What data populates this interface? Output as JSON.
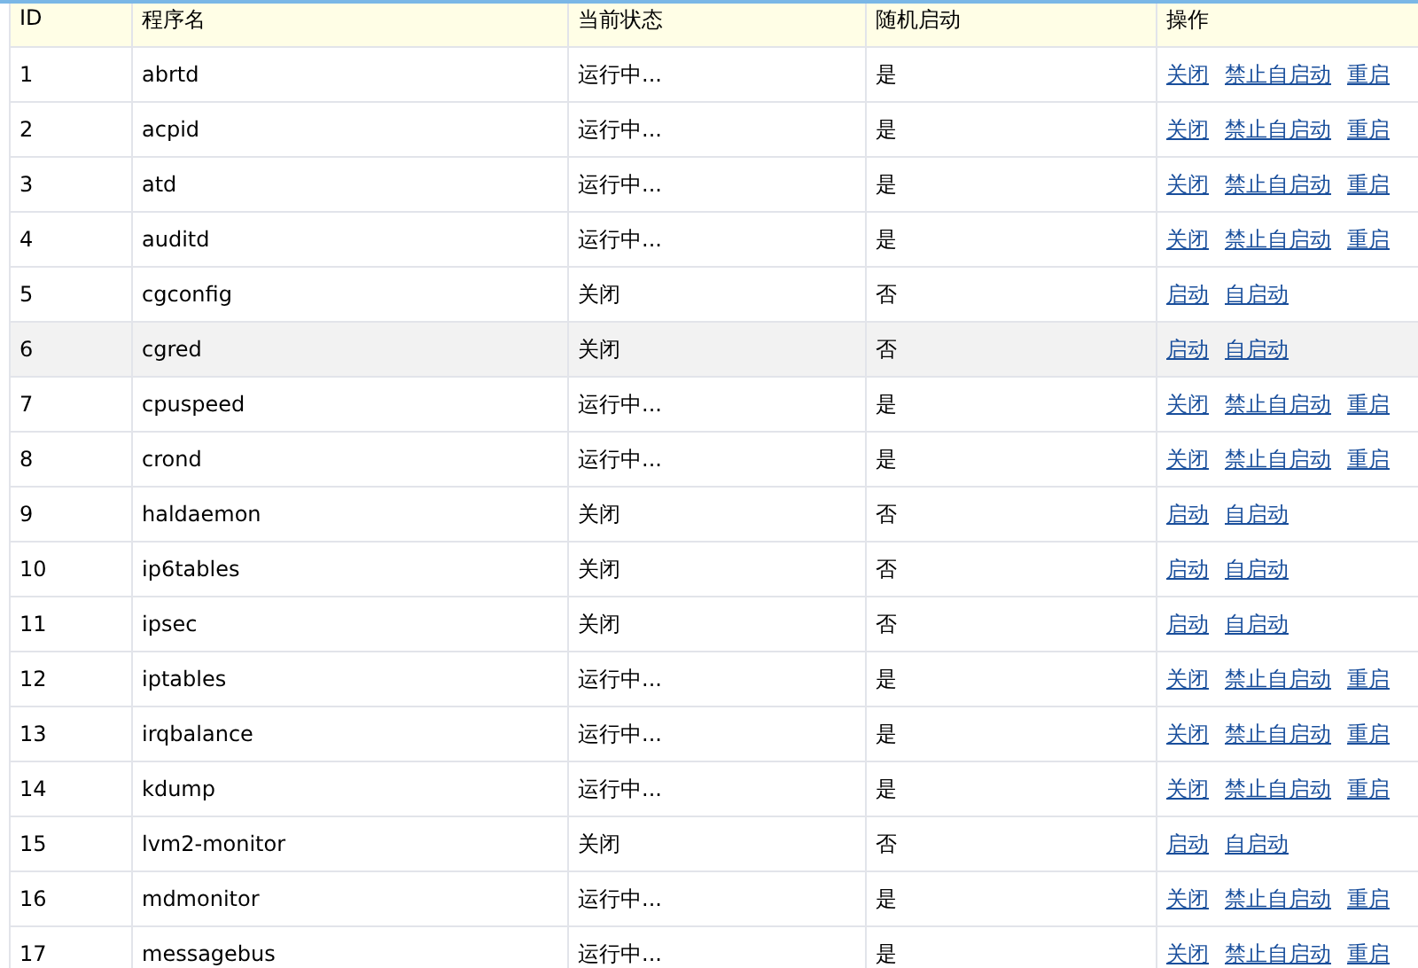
{
  "table": {
    "columns": [
      "ID",
      "程序名",
      "当前状态",
      "随机启动",
      "操作"
    ],
    "rows": [
      {
        "id": "1",
        "name": "abrtd",
        "status": "运行中...",
        "autostart": "是",
        "selected": false,
        "actions": [
          "关闭",
          "禁止自启动",
          "重启"
        ]
      },
      {
        "id": "2",
        "name": "acpid",
        "status": "运行中...",
        "autostart": "是",
        "selected": false,
        "actions": [
          "关闭",
          "禁止自启动",
          "重启"
        ]
      },
      {
        "id": "3",
        "name": "atd",
        "status": "运行中...",
        "autostart": "是",
        "selected": false,
        "actions": [
          "关闭",
          "禁止自启动",
          "重启"
        ]
      },
      {
        "id": "4",
        "name": "auditd",
        "status": "运行中...",
        "autostart": "是",
        "selected": false,
        "actions": [
          "关闭",
          "禁止自启动",
          "重启"
        ]
      },
      {
        "id": "5",
        "name": "cgconfig",
        "status": "关闭",
        "autostart": "否",
        "selected": false,
        "actions": [
          "启动",
          "自启动"
        ]
      },
      {
        "id": "6",
        "name": "cgred",
        "status": "关闭",
        "autostart": "否",
        "selected": true,
        "actions": [
          "启动",
          "自启动"
        ]
      },
      {
        "id": "7",
        "name": "cpuspeed",
        "status": "运行中...",
        "autostart": "是",
        "selected": false,
        "actions": [
          "关闭",
          "禁止自启动",
          "重启"
        ]
      },
      {
        "id": "8",
        "name": "crond",
        "status": "运行中...",
        "autostart": "是",
        "selected": false,
        "actions": [
          "关闭",
          "禁止自启动",
          "重启"
        ]
      },
      {
        "id": "9",
        "name": "haldaemon",
        "status": "关闭",
        "autostart": "否",
        "selected": false,
        "actions": [
          "启动",
          "自启动"
        ]
      },
      {
        "id": "10",
        "name": "ip6tables",
        "status": "关闭",
        "autostart": "否",
        "selected": false,
        "actions": [
          "启动",
          "自启动"
        ]
      },
      {
        "id": "11",
        "name": "ipsec",
        "status": "关闭",
        "autostart": "否",
        "selected": false,
        "actions": [
          "启动",
          "自启动"
        ]
      },
      {
        "id": "12",
        "name": "iptables",
        "status": "运行中...",
        "autostart": "是",
        "selected": false,
        "actions": [
          "关闭",
          "禁止自启动",
          "重启"
        ]
      },
      {
        "id": "13",
        "name": "irqbalance",
        "status": "运行中...",
        "autostart": "是",
        "selected": false,
        "actions": [
          "关闭",
          "禁止自启动",
          "重启"
        ]
      },
      {
        "id": "14",
        "name": "kdump",
        "status": "运行中...",
        "autostart": "是",
        "selected": false,
        "actions": [
          "关闭",
          "禁止自启动",
          "重启"
        ]
      },
      {
        "id": "15",
        "name": "lvm2-monitor",
        "status": "关闭",
        "autostart": "否",
        "selected": false,
        "actions": [
          "启动",
          "自启动"
        ]
      },
      {
        "id": "16",
        "name": "mdmonitor",
        "status": "运行中...",
        "autostart": "是",
        "selected": false,
        "actions": [
          "关闭",
          "禁止自启动",
          "重启"
        ]
      },
      {
        "id": "17",
        "name": "messagebus",
        "status": "运行中...",
        "autostart": "是",
        "selected": false,
        "actions": [
          "关闭",
          "禁止自启动",
          "重启"
        ]
      }
    ]
  }
}
